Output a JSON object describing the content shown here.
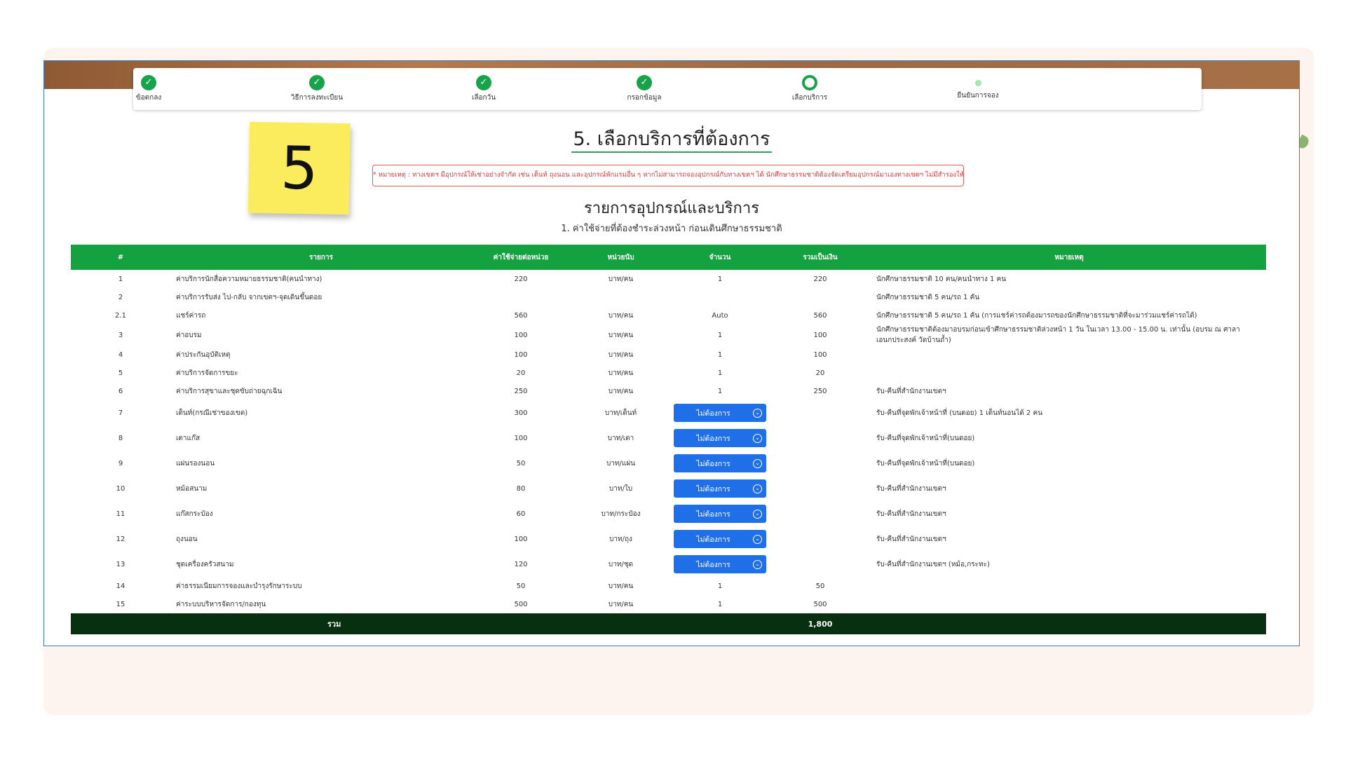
{
  "steps": [
    {
      "label": "ข้อตกลง",
      "state": "done"
    },
    {
      "label": "วิธีการลงทะเบียน",
      "state": "done"
    },
    {
      "label": "เลือกวัน",
      "state": "done"
    },
    {
      "label": "กรอกข้อมูล",
      "state": "done"
    },
    {
      "label": "เลือกบริการ",
      "state": "current"
    },
    {
      "label": "ยืนยันการจอง",
      "state": "future"
    }
  ],
  "check_glyph": "✓",
  "sticky_note": "5",
  "page_title": "5. เลือกบริการที่ต้องการ",
  "warning": "* หมายเหตุ : ทางเขตฯ มีอุปกรณ์ให้เช่าอย่างจำกัด เช่น เต็นท์ ถุงนอน และอุปกรณ์พักแรมอื่น ๆ หากไม่สามารถจองอุปกรณ์กับทางเขตฯ ได้ นักศึกษาธรรมชาติต้องจัดเตรียมอุปกรณ์มาเองทางเขตฯ ไม่มีสำรองให้ยืม",
  "section_title": "รายการอุปกรณ์และบริการ",
  "section_subtitle": "1. ค่าใช้จ่ายที่ต้องชำระล่วงหน้า ก่อนเดินศึกษาธรรมชาติ",
  "table": {
    "headers": [
      "#",
      "รายการ",
      "ค่าใช้จ่ายต่อหน่วย",
      "หน่วยนับ",
      "จำนวน",
      "รวมเป็นเงิน",
      "หมายเหตุ"
    ],
    "select_label": "ไม่ต้องการ",
    "rows": [
      {
        "no": "1",
        "item": "ค่าบริการนักสื่อความหมายธรรมชาติ(คนนำทาง)",
        "price": "220",
        "unit": "บาท/คน",
        "qty": "1",
        "total": "220",
        "note": "นักศึกษาธรรมชาติ 10 คน/คนนำทาง 1 คน",
        "select": false
      },
      {
        "no": "2",
        "item": "ค่าบริการรับส่ง ไป-กลับ จากเขตฯ-จุดเดินขึ้นดอย",
        "price": "",
        "unit": "",
        "qty": "",
        "total": "",
        "note": "นักศึกษาธรรมชาติ 5 คน/รถ 1 คัน",
        "select": false
      },
      {
        "no": "2.1",
        "item": "แชร์ค่ารถ",
        "price": "560",
        "unit": "บาท/คน",
        "qty": "Auto",
        "total": "560",
        "note": "นักศึกษาธรรมชาติ 5 คน/รถ 1 คัน (การแชร์ค่ารถต้องมารถของนักศึกษาธรรมชาติที่จะมาร่วมแชร์ค่ารถได้)",
        "select": false
      },
      {
        "no": "3",
        "item": "ค่าอบรม",
        "price": "100",
        "unit": "บาท/คน",
        "qty": "1",
        "total": "100",
        "note": "นักศึกษาธรรมชาติต้องมาอบรมก่อนเข้าศึกษาธรรมชาติล่วงหน้า 1 วัน ในเวลา 13.00 - 15.00 น. เท่านั้น (อบรม ณ ศาลาเอนกประสงค์ วัดบ้านถ้ำ)",
        "select": false
      },
      {
        "no": "4",
        "item": "ค่าประกันอุบัติเหตุ",
        "price": "100",
        "unit": "บาท/คน",
        "qty": "1",
        "total": "100",
        "note": "",
        "select": false
      },
      {
        "no": "5",
        "item": "ค่าบริการจัดการขยะ",
        "price": "20",
        "unit": "บาท/คน",
        "qty": "1",
        "total": "20",
        "note": "",
        "select": false
      },
      {
        "no": "6",
        "item": "ค่าบริการสุขาและชุดขับถ่ายฉุกเฉิน",
        "price": "250",
        "unit": "บาท/คน",
        "qty": "1",
        "total": "250",
        "note": "รับ-คืนที่สำนักงานเขตฯ",
        "select": false
      },
      {
        "no": "7",
        "item": "เต็นท์(กรณีเช่าของเขต)",
        "price": "300",
        "unit": "บาท/เต็นท์",
        "qty": "",
        "total": "",
        "note": "รับ-คืนที่จุดพักเจ้าหน้าที่ (บนดอย) 1 เต็นท์นอนได้ 2 คน",
        "select": true
      },
      {
        "no": "8",
        "item": "เตาแก๊ส",
        "price": "100",
        "unit": "บาท/เตา",
        "qty": "",
        "total": "",
        "note": "รับ-คืนที่จุดพักเจ้าหน้าที่(บนดอย)",
        "select": true
      },
      {
        "no": "9",
        "item": "แผ่นรองนอน",
        "price": "50",
        "unit": "บาท/แผ่น",
        "qty": "",
        "total": "",
        "note": "รับ-คืนที่จุดพักเจ้าหน้าที่(บนดอย)",
        "select": true
      },
      {
        "no": "10",
        "item": "หม้อสนาม",
        "price": "80",
        "unit": "บาท/ใบ",
        "qty": "",
        "total": "",
        "note": "รับ-คืนที่สำนักงานเขตฯ",
        "select": true
      },
      {
        "no": "11",
        "item": "แก๊สกระป๋อง",
        "price": "60",
        "unit": "บาท/กระป๋อง",
        "qty": "",
        "total": "",
        "note": "รับ-คืนที่สำนักงานเขตฯ",
        "select": true
      },
      {
        "no": "12",
        "item": "ถุงนอน",
        "price": "100",
        "unit": "บาท/ถุง",
        "qty": "",
        "total": "",
        "note": "รับ-คืนที่สำนักงานเขตฯ",
        "select": true
      },
      {
        "no": "13",
        "item": "ชุดเครื่องครัวสนาม",
        "price": "120",
        "unit": "บาท/ชุด",
        "qty": "",
        "total": "",
        "note": "รับ-คืนที่สำนักงานเขตฯ (หม้อ,กระทะ)",
        "select": true
      },
      {
        "no": "14",
        "item": "ค่าธรรมเนียมการจองและบำรุงรักษาระบบ",
        "price": "50",
        "unit": "บาท/คน",
        "qty": "1",
        "total": "50",
        "note": "",
        "select": false
      },
      {
        "no": "15",
        "item": "ค่าระบบบริหารจัดการ/กองทุน",
        "price": "500",
        "unit": "บาท/คน",
        "qty": "1",
        "total": "500",
        "note": "",
        "select": false
      }
    ],
    "total_label": "รวม",
    "total_value": "1,800"
  },
  "colors": {
    "green": "#13a23f",
    "dark_green": "#06300f",
    "blue": "#1f6fe8",
    "warn_red": "#d23a3a",
    "note_yellow": "#fbec5d"
  },
  "icons": {
    "step_done": "check-circle-icon",
    "select_arrow": "chevron-down-circle-icon"
  }
}
